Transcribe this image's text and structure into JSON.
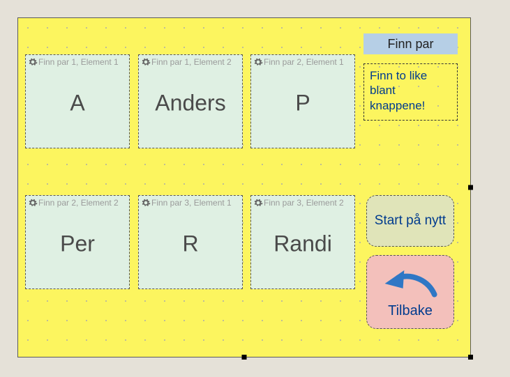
{
  "title": "Finn par",
  "instruction": "Finn to like blant knappene!",
  "cards": [
    {
      "design_label": "Finn par 1, Element 1",
      "text": "A"
    },
    {
      "design_label": "Finn par 1, Element 2",
      "text": "Anders"
    },
    {
      "design_label": "Finn par 2, Element 1",
      "text": "P"
    },
    {
      "design_label": "Finn par 2, Element 2",
      "text": "Per"
    },
    {
      "design_label": "Finn par 3, Element 1",
      "text": "R"
    },
    {
      "design_label": "Finn par 3, Element 2",
      "text": "Randi"
    }
  ],
  "restart_label": "Start på nytt",
  "back_label": "Tilbake"
}
